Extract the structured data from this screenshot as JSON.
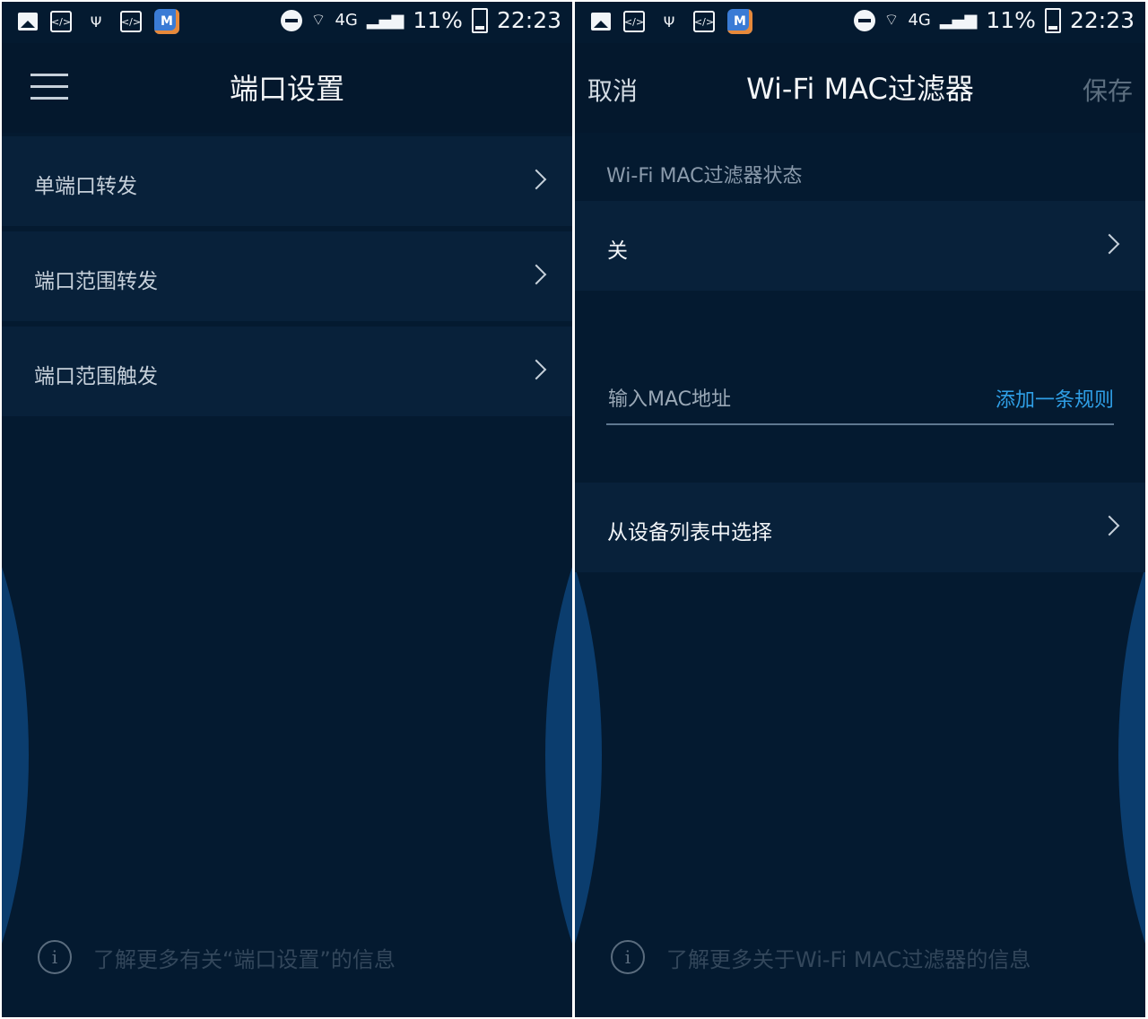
{
  "status_bar": {
    "battery": "11%",
    "time": "22:23",
    "icons": [
      "image-icon",
      "code-icon",
      "usb-icon",
      "code-icon",
      "app-icon",
      "dnd-icon",
      "wifi-icon",
      "4g-icon",
      "signal-icon",
      "battery-icon"
    ],
    "network_label": "4G",
    "app_badge": "M"
  },
  "left_screen": {
    "title": "端口设置",
    "menu_items": [
      {
        "label": "单端口转发"
      },
      {
        "label": "端口范围转发"
      },
      {
        "label": "端口范围触发"
      }
    ],
    "footer_text": "了解更多有关“端口设置”的信息"
  },
  "right_screen": {
    "cancel_label": "取消",
    "title": "Wi-Fi MAC过滤器",
    "save_label": "保存",
    "status_section_label": "Wi-Fi MAC过滤器状态",
    "status_value": "关",
    "mac_input_placeholder": "输入MAC地址",
    "add_rule_label": "添加一条规则",
    "select_from_list_label": "从设备列表中选择",
    "footer_text": "了解更多关于Wi-Fi MAC过滤器的信息"
  },
  "colors": {
    "background": "#041a30",
    "row": "#08213a",
    "accent": "#2f9fe6"
  }
}
